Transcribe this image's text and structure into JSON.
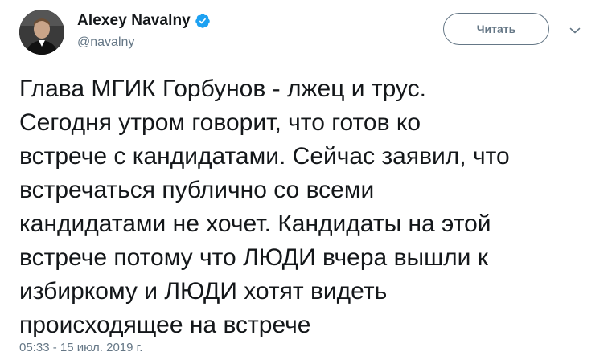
{
  "author": {
    "display_name": "Alexey Navalny",
    "handle": "@navalny",
    "verified": true,
    "avatar_icon": "user-avatar"
  },
  "follow_button": {
    "label": "Читать"
  },
  "menu": {
    "icon": "chevron-down-icon"
  },
  "tweet": {
    "text": "Глава МГИК Горбунов - лжец и трус.\nСегодня утром говорит, что готов ко\nвстрече с кандидатами. Сейчас заявил, что\nвстречаться публично со всеми\nкандидатами не хочет. Кандидаты на этой\nвстрече потому что ЛЮДИ вчера вышли к\nизбиркому и ЛЮДИ хотят видеть\nпроисходящее на встрече",
    "timestamp": "05:33 - 15 июл. 2019 г."
  },
  "colors": {
    "verified_blue": "#1da1f2",
    "text_primary": "#14171a",
    "text_secondary": "#657786"
  }
}
